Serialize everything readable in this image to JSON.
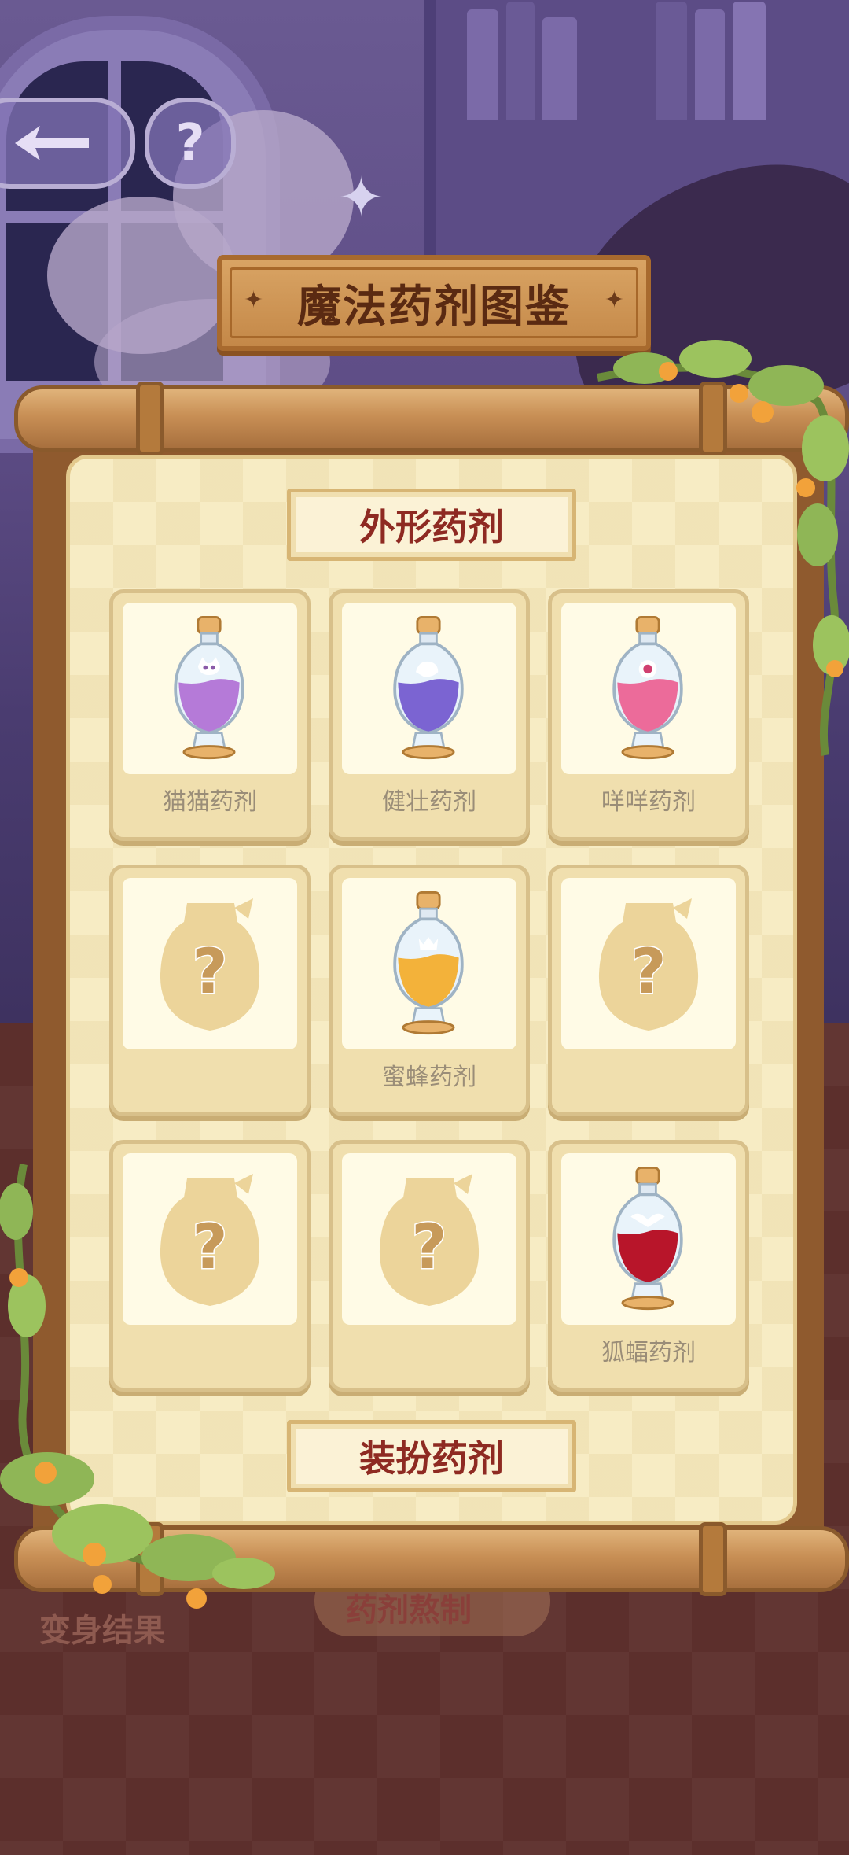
{
  "header": {
    "back_icon": "arrow-back-icon",
    "help_label": "?"
  },
  "title": "魔法药剂图鉴",
  "sections": [
    {
      "label": "外形药剂"
    },
    {
      "label": "装扮药剂"
    }
  ],
  "potions": [
    {
      "name": "猫猫药剂",
      "unlocked": true,
      "color": "#b57ad8",
      "emblem": "cat"
    },
    {
      "name": "健壮药剂",
      "unlocked": true,
      "color": "#7b64d2",
      "emblem": "muscle"
    },
    {
      "name": "咩咩药剂",
      "unlocked": true,
      "color": "#ec6b9a",
      "emblem": "sheep"
    },
    {
      "name": "",
      "unlocked": false,
      "color": "#ecd49a",
      "emblem": "question"
    },
    {
      "name": "蜜蜂药剂",
      "unlocked": true,
      "color": "#f3b23a",
      "emblem": "bee"
    },
    {
      "name": "",
      "unlocked": false,
      "color": "#ecd49a",
      "emblem": "question"
    },
    {
      "name": "",
      "unlocked": false,
      "color": "#ecd49a",
      "emblem": "question"
    },
    {
      "name": "",
      "unlocked": false,
      "color": "#ecd49a",
      "emblem": "question"
    },
    {
      "name": "狐蝠药剂",
      "unlocked": true,
      "color": "#b8152a",
      "emblem": "bat"
    }
  ],
  "background": {
    "left_label": "变身结果",
    "center_button": "药剂熬制"
  },
  "colors": {
    "title_text": "#5a2a12",
    "section_text": "#8e2a22",
    "card_label": "#9a8d78"
  }
}
